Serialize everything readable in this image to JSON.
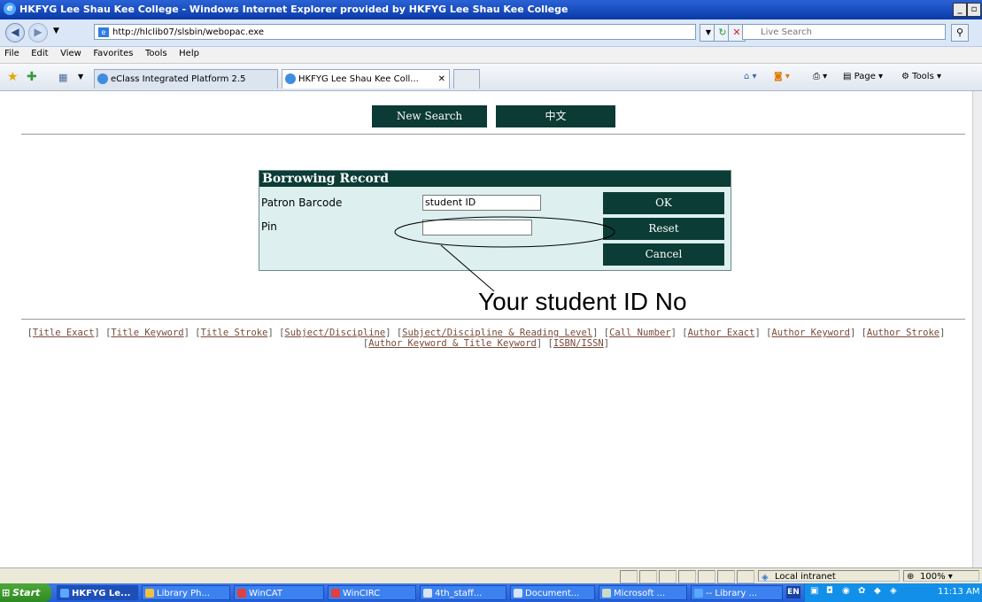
{
  "window": {
    "title": "HKFYG Lee Shau Kee College - Windows Internet Explorer provided by HKFYG Lee Shau Kee College"
  },
  "address": {
    "url": "http://hlclib07/slsbin/webopac.exe",
    "search_placeholder": "Live Search"
  },
  "menu": [
    "File",
    "Edit",
    "View",
    "Favorites",
    "Tools",
    "Help"
  ],
  "tabs": {
    "tab1": "eClass Integrated Platform 2.5",
    "tab2": "HKFYG Lee Shau Kee Coll...",
    "page_label": "Page",
    "tools_label": "Tools"
  },
  "nav": {
    "new_search": "New Search",
    "chinese": "中文"
  },
  "panel": {
    "title": "Borrowing Record",
    "barcode_label": "Patron Barcode",
    "barcode_value": "student ID",
    "pin_label": "Pin",
    "pin_value": "",
    "ok": "OK",
    "reset": "Reset",
    "cancel": "Cancel"
  },
  "annotation": "Your student ID No",
  "links": {
    "l1": "Title Exact",
    "l2": "Title Keyword",
    "l3": "Title Stroke",
    "l4": "Subject/Discipline",
    "l5": "Subject/Discipline & Reading Level",
    "l6": "Call Number",
    "l7": "Author Exact",
    "l8": "Author Keyword",
    "l9": "Author Stroke",
    "l10": "Author Keyword & Title Keyword",
    "l11": "ISBN/ISSN"
  },
  "status": {
    "zone": "Local intranet",
    "zoom": "100%"
  },
  "taskbar": {
    "start": "Start",
    "items": [
      "HKFYG Le...",
      "Library Ph...",
      "WinCAT",
      "WinCIRC",
      "4th_staff...",
      "Document...",
      "Microsoft ...",
      "-- Library ..."
    ],
    "lang": "EN",
    "time": "11:13 AM"
  }
}
